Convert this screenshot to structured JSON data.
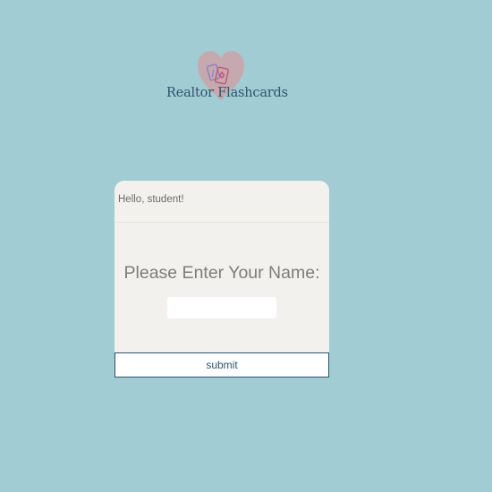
{
  "brand": {
    "name": "Realtor Flashcards",
    "logo_icon": "heart-flashcards-logo-icon",
    "colors": {
      "background": "#a2ccd3",
      "heart": "#c8a7ac",
      "text": "#2f5370"
    }
  },
  "card": {
    "greeting": "Hello, student!",
    "prompt": "Please Enter Your Name:",
    "name_input": {
      "value": "",
      "placeholder": ""
    }
  },
  "actions": {
    "submit_label": "submit"
  }
}
